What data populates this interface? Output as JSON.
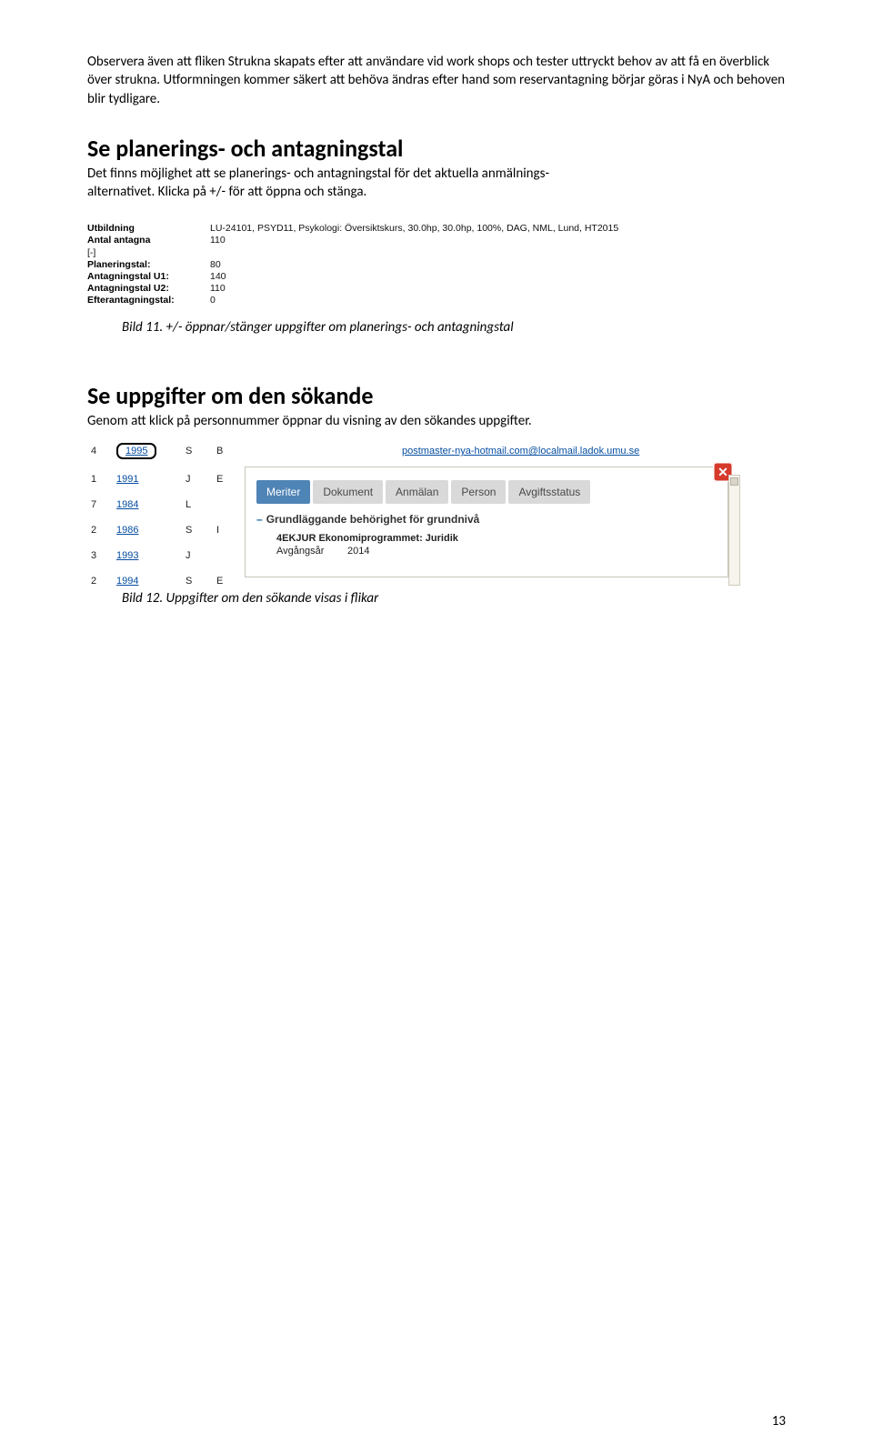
{
  "para1": "Observera även att fliken Strukna skapats efter att användare vid work shops och tester uttryckt behov av att få en överblick över strukna. Utformningen kommer säkert att behöva ändras efter hand som reservantagning börjar göras i NyA och behoven blir tydligare.",
  "h2_1": "Se planerings- och antagningstal",
  "sub1": "Det finns möjlighet att se planerings- och antagningstal för det aktuella anmälnings-\nalternativet. Klicka på +/- för att öppna och stänga.",
  "img1": {
    "utbildning_label": "Utbildning",
    "utbildning_value": "LU-24101, PSYD11, Psykologi: Översiktskurs, 30.0hp, 30.0hp, 100%, DAG, NML, Lund, HT2015",
    "antal_label": "Antal antagna",
    "antal_value": "110",
    "collapse": "[-]",
    "rows": [
      {
        "k": "Planeringstal:",
        "v": "80"
      },
      {
        "k": "Antagningstal U1:",
        "v": "140"
      },
      {
        "k": "Antagningstal U2:",
        "v": "110"
      },
      {
        "k": "Efterantagningstal:",
        "v": "0"
      }
    ]
  },
  "cap1_lead": "Bild 11. ",
  "cap1_rest": "+/- öppnar/stänger uppgifter om planerings- och antagningstal",
  "h2_2": "Se uppgifter om den sökande",
  "sub2": "Genom att klick på personnummer öppnar du visning av den sökandes uppgifter.",
  "img2": {
    "toprow": {
      "n": "4",
      "pnr": "1995",
      "c1": "S",
      "c2": "B",
      "email": "postmaster-nya-hotmail.com@localmail.ladok.umu.se"
    },
    "leftrows": [
      {
        "n": "1",
        "pnr": "1991",
        "c1": "J",
        "c2": "E"
      },
      {
        "n": "7",
        "pnr": "1984",
        "c1": "L",
        "c2": ""
      },
      {
        "n": "2",
        "pnr": "1986",
        "c1": "S",
        "c2": "I"
      },
      {
        "n": "3",
        "pnr": "1993",
        "c1": "J",
        "c2": ""
      },
      {
        "n": "2",
        "pnr": "1994",
        "c1": "S",
        "c2": "E"
      }
    ],
    "tabs": [
      "Meriter",
      "Dokument",
      "Anmälan",
      "Person",
      "Avgiftsstatus"
    ],
    "panel_h": "Grundläggande behörighet för grundnivå",
    "prog_name": "4EKJUR Ekonomiprogrammet: Juridik",
    "prog_year_k": "Avgångsår",
    "prog_year_v": "2014"
  },
  "cap2_lead": "Bild 12. ",
  "cap2_rest": "Uppgifter om den sökande visas i flikar",
  "pagen": "13"
}
